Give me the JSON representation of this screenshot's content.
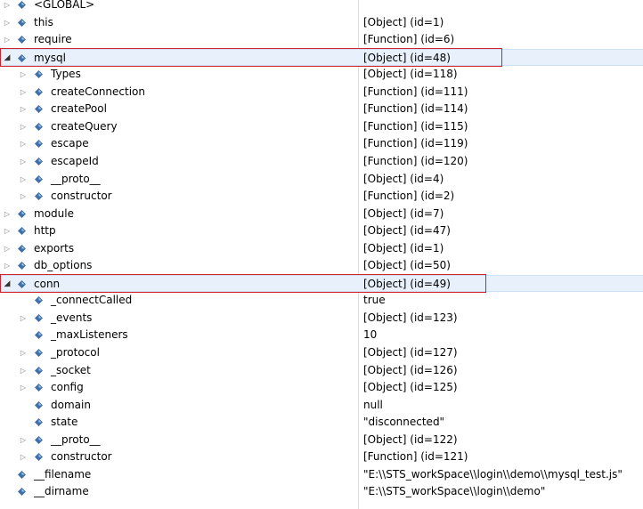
{
  "variables": [
    {
      "name": "<GLOBAL>",
      "value": "",
      "level": 0,
      "toggle": "collapsed"
    },
    {
      "name": "this",
      "value": "[Object]  (id=1)",
      "level": 0,
      "toggle": "collapsed"
    },
    {
      "name": "require",
      "value": "[Function]  (id=6)",
      "level": 0,
      "toggle": "collapsed"
    },
    {
      "name": "mysql",
      "value": "[Object]  (id=48)",
      "level": 0,
      "toggle": "expanded"
    },
    {
      "name": "Types",
      "value": "[Object]  (id=118)",
      "level": 1,
      "toggle": "collapsed"
    },
    {
      "name": "createConnection",
      "value": "[Function]  (id=111)",
      "level": 1,
      "toggle": "collapsed"
    },
    {
      "name": "createPool",
      "value": "[Function]  (id=114)",
      "level": 1,
      "toggle": "collapsed"
    },
    {
      "name": "createQuery",
      "value": "[Function]  (id=115)",
      "level": 1,
      "toggle": "collapsed"
    },
    {
      "name": "escape",
      "value": "[Function]  (id=119)",
      "level": 1,
      "toggle": "collapsed"
    },
    {
      "name": "escapeId",
      "value": "[Function]  (id=120)",
      "level": 1,
      "toggle": "collapsed"
    },
    {
      "name": "__proto__",
      "value": "[Object]  (id=4)",
      "level": 1,
      "toggle": "collapsed"
    },
    {
      "name": "constructor",
      "value": "[Function]  (id=2)",
      "level": 1,
      "toggle": "collapsed"
    },
    {
      "name": "module",
      "value": "[Object]  (id=7)",
      "level": 0,
      "toggle": "collapsed"
    },
    {
      "name": "http",
      "value": "[Object]  (id=47)",
      "level": 0,
      "toggle": "collapsed"
    },
    {
      "name": "exports",
      "value": "[Object]  (id=1)",
      "level": 0,
      "toggle": "collapsed"
    },
    {
      "name": "db_options",
      "value": "[Object]  (id=50)",
      "level": 0,
      "toggle": "collapsed"
    },
    {
      "name": "conn",
      "value": "[Object]  (id=49)",
      "level": 0,
      "toggle": "expanded"
    },
    {
      "name": "_connectCalled",
      "value": "true",
      "level": 1,
      "toggle": "none"
    },
    {
      "name": "_events",
      "value": "[Object]  (id=123)",
      "level": 1,
      "toggle": "collapsed"
    },
    {
      "name": "_maxListeners",
      "value": "10",
      "level": 1,
      "toggle": "none"
    },
    {
      "name": "_protocol",
      "value": "[Object]  (id=127)",
      "level": 1,
      "toggle": "collapsed"
    },
    {
      "name": "_socket",
      "value": "[Object]  (id=126)",
      "level": 1,
      "toggle": "collapsed"
    },
    {
      "name": "config",
      "value": "[Object]  (id=125)",
      "level": 1,
      "toggle": "collapsed"
    },
    {
      "name": "domain",
      "value": "null",
      "level": 1,
      "toggle": "none"
    },
    {
      "name": "state",
      "value": "\"disconnected\"",
      "level": 1,
      "toggle": "none"
    },
    {
      "name": "__proto__",
      "value": "[Object]  (id=122)",
      "level": 1,
      "toggle": "collapsed"
    },
    {
      "name": "constructor",
      "value": "[Function]  (id=121)",
      "level": 1,
      "toggle": "collapsed"
    },
    {
      "name": "__filename",
      "value": "\"E:\\\\STS_workSpace\\\\login\\\\demo\\\\mysql_test.js\"",
      "level": 0,
      "toggle": "none"
    },
    {
      "name": "__dirname",
      "value": "\"E:\\\\STS_workSpace\\\\login\\\\demo\"",
      "level": 0,
      "toggle": "none"
    }
  ],
  "selected_rows": [
    3,
    16
  ],
  "highlighted_rows": [
    3,
    16
  ],
  "colors": {
    "variable_icon": "#3f6fa8",
    "highlight_border": "#d4202a",
    "selection": "#e8f1fb"
  },
  "icons": {
    "collapsed": "expand-arrow-icon",
    "expanded": "collapse-arrow-icon",
    "variable": "variable-icon"
  }
}
